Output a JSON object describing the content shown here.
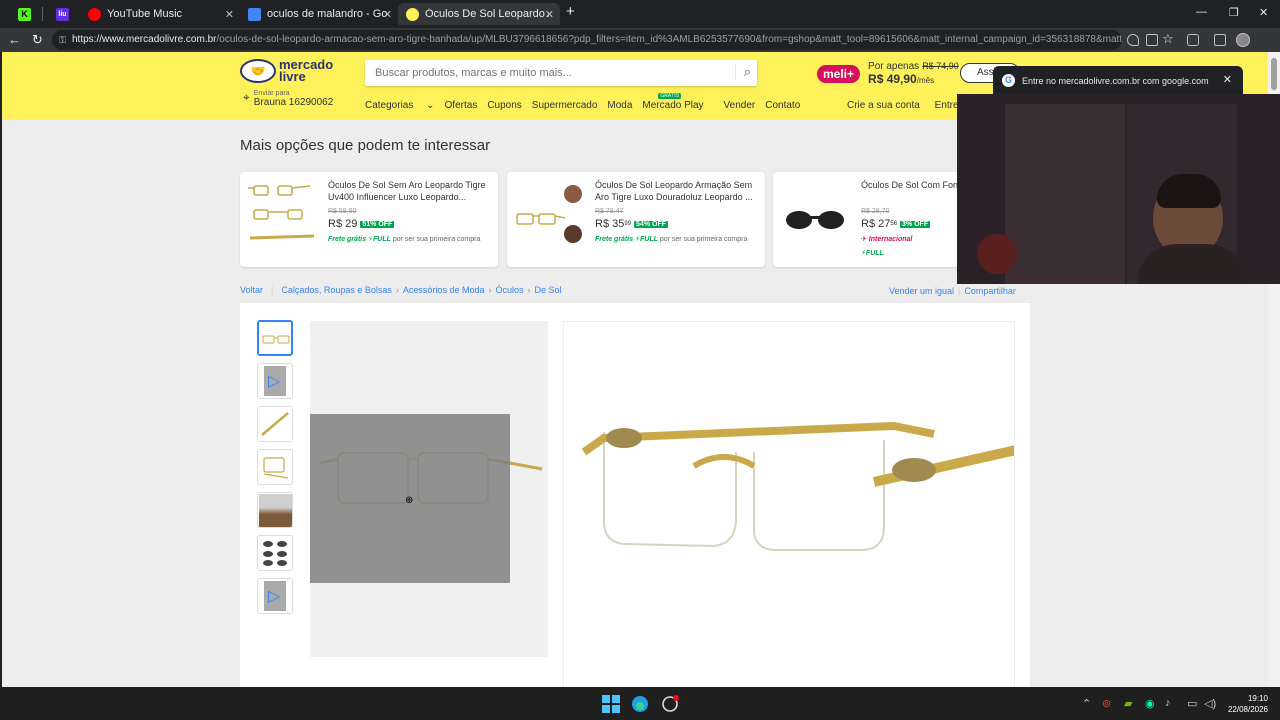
{
  "browser": {
    "tabs": [
      {
        "title": "",
        "favicon": "K"
      },
      {
        "title": "",
        "favicon": "liu"
      },
      {
        "title": "YouTube Music",
        "favicon": "youtube-music"
      },
      {
        "title": "oculos de malandro - Google Shop",
        "favicon": "google-shopping"
      },
      {
        "title": "Óculos De Sol Leopardo Armação",
        "favicon": "mercadolivre",
        "active": true
      }
    ],
    "new_tab": "+",
    "url_host": "https://www.mercadolivre.com.br",
    "url_path": "/oculos-de-sol-leopardo-armacao-sem-aro-tigre-banhada/up/MLBU3796618656?pdp_filters=item_id%3AMLB6253577690&from=gshop&matt_tool=89615606&matt_internal_campaign_id=356318878&matt_word=&m..."
  },
  "header": {
    "logo_text": "mercado livre",
    "search_placeholder": "Buscar produtos, marcas e muito mais...",
    "promo": {
      "badge": "meli+",
      "line1": "Por apenas",
      "old_price": "R$ 74,90",
      "price": "R$ 49,90",
      "per": "/mês",
      "cta": "Assi"
    },
    "location": {
      "label": "Enviar para",
      "value": "Brauna 16290062"
    },
    "nav": [
      "Categorias",
      "Ofertas",
      "Cupons",
      "Supermercado",
      "Moda",
      "Mercado Play",
      "Vender",
      "Contato"
    ],
    "nav_badge": "GRÁTIS",
    "nav_right": [
      "Crie a sua conta",
      "Entre"
    ]
  },
  "section_title": "Mais opções que podem te interessar",
  "cards": [
    {
      "title": "Óculos De Sol Sem Aro Leopardo Tigre Uv400 Influencer Luxo Leopardo...",
      "old_price": "R$ 59,80",
      "price": "R$ 29",
      "cents": "",
      "off": "51% OFF",
      "ship_green": "Frete grátis",
      "full": "⚡FULL",
      "ship_rest": "por ser sua primeira compra"
    },
    {
      "title": "Óculos De Sol Leopardo Armação Sem Aro Tigre Luxo Douradoluz Leopardo ...",
      "old_price": "R$ 78,47",
      "price": "R$ 35",
      "cents": "99",
      "off": "54% OFF",
      "ship_green": "Frete grátis",
      "full": "⚡FULL",
      "ship_rest": "por ser sua primeira compra"
    },
    {
      "title": "Óculos De Sol Com Fon Preto",
      "old_price": "R$ 28,70",
      "price": "R$ 27",
      "cents": "56",
      "off": "3% OFF",
      "intl": "✈ Internacional",
      "full": "⚡FULL"
    }
  ],
  "breadcrumb": {
    "back": "Voltar",
    "items": [
      "Calçados, Roupas e Bolsas",
      "Acessórios de Moda",
      "Óculos",
      "De Sol"
    ]
  },
  "actions": [
    "Vender um igual",
    "Compartilhar"
  ],
  "popup": {
    "text": "Entre no mercadolivre.com.br com google.com"
  },
  "taskbar": {
    "time": "19:10",
    "date": "22/08/2026"
  },
  "colors": {
    "brand_yellow": "#fff159",
    "accent_blue": "#3483fa",
    "discount_green": "#00a650",
    "meli_pink": "#d6105d"
  }
}
